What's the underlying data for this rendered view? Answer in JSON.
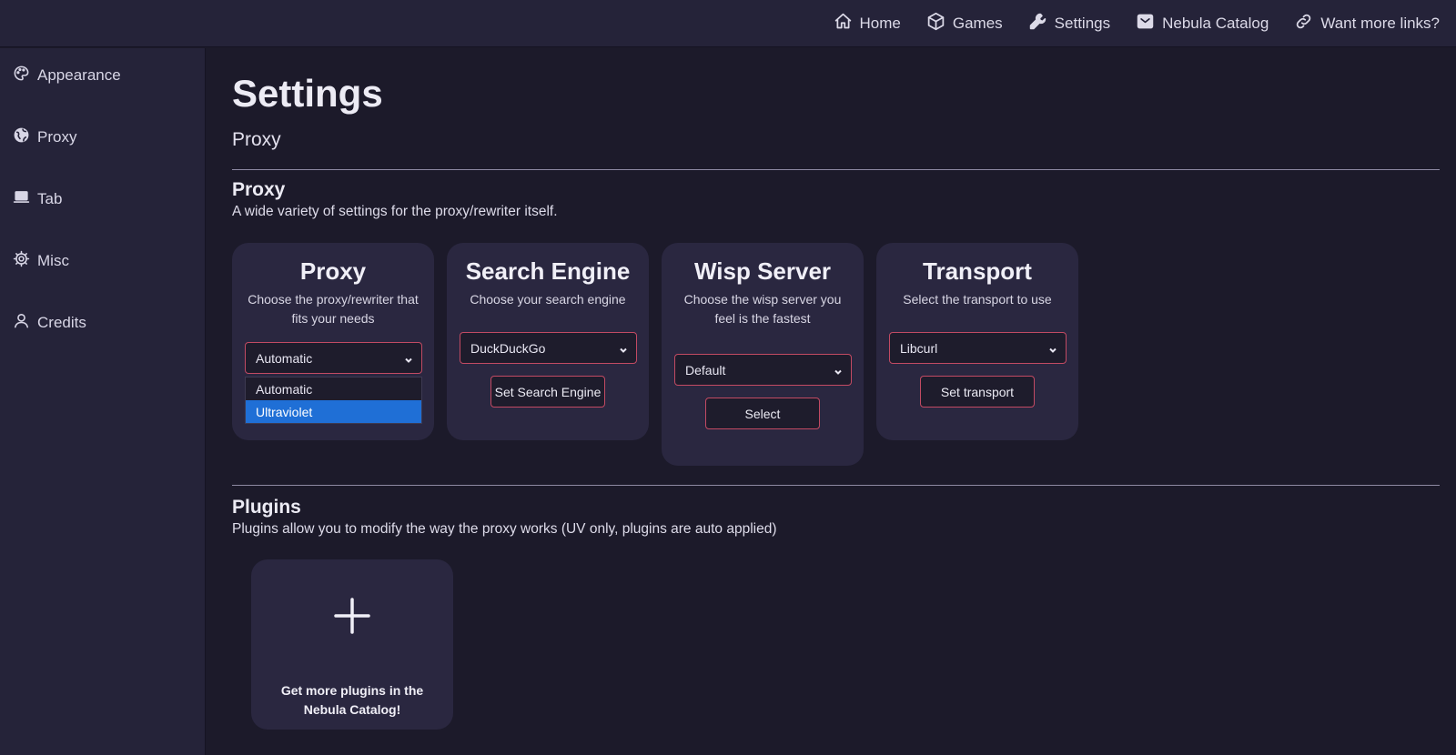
{
  "nav": {
    "items": [
      {
        "label": "Home",
        "icon": "home-icon"
      },
      {
        "label": "Games",
        "icon": "cube-icon"
      },
      {
        "label": "Settings",
        "icon": "wrench-icon"
      },
      {
        "label": "Nebula Catalog",
        "icon": "catalog-icon"
      },
      {
        "label": "Want more links?",
        "icon": "link-icon"
      }
    ]
  },
  "sidebar": {
    "items": [
      {
        "label": "Appearance",
        "icon": "palette-icon"
      },
      {
        "label": "Proxy",
        "icon": "globe-icon"
      },
      {
        "label": "Tab",
        "icon": "laptop-icon"
      },
      {
        "label": "Misc",
        "icon": "gear-icon"
      },
      {
        "label": "Credits",
        "icon": "user-icon"
      }
    ]
  },
  "page": {
    "title": "Settings",
    "subtitle": "Proxy"
  },
  "proxy_section": {
    "title": "Proxy",
    "description": "A wide variety of settings for the proxy/rewriter itself."
  },
  "cards": {
    "proxy": {
      "title": "Proxy",
      "description": "Choose the proxy/rewriter that fits your needs",
      "selected": "Automatic",
      "options": [
        "Automatic",
        "Ultraviolet"
      ],
      "highlighted_option": "Ultraviolet"
    },
    "search": {
      "title": "Search Engine",
      "description": "Choose your search engine",
      "selected": "DuckDuckGo",
      "button": "Set Search Engine"
    },
    "wisp": {
      "title": "Wisp Server",
      "description": "Choose the wisp server you feel is the fastest",
      "selected": "Default",
      "button": "Select"
    },
    "transport": {
      "title": "Transport",
      "description": "Select the transport to use",
      "selected": "Libcurl",
      "button": "Set transport"
    }
  },
  "plugins_section": {
    "title": "Plugins",
    "description": "Plugins allow you to modify the way the proxy works (UV only, plugins are auto applied)",
    "card_text_prefix": "Get more plugins in the ",
    "card_text_link": "Nebula Catalog!"
  },
  "colors": {
    "background": "#1c1a2a",
    "panel": "#252339",
    "card": "#2a2740",
    "accent_border": "#c24a63",
    "selected_option": "#1f6fd6"
  }
}
